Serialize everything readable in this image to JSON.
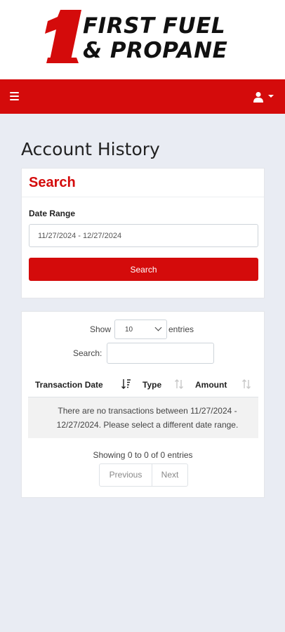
{
  "brand": {
    "line1": "FIRST FUEL",
    "line2": "& PROPANE",
    "numeral": "1",
    "red": "#d40b0b"
  },
  "navbar": {
    "menu_icon": "hamburger-icon",
    "user_icon": "user-icon",
    "caret_icon": "caret-down-icon"
  },
  "page": {
    "title": "Account History"
  },
  "search": {
    "title": "Search",
    "date_range_label": "Date Range",
    "date_range_value": "11/27/2024 - 12/27/2024",
    "button_label": "Search"
  },
  "table": {
    "show_label": "Show",
    "length_value": "10",
    "entries_label": "entries",
    "filter_label": "Search:",
    "columns": [
      "Transaction Date",
      "Type",
      "Amount"
    ],
    "sort_icon": "sort-icon",
    "empty_message": "There are no transactions between 11/27/2024 - 12/27/2024. Please select a different date range.",
    "info": "Showing 0 to 0 of 0 entries",
    "prev_label": "Previous",
    "next_label": "Next"
  }
}
